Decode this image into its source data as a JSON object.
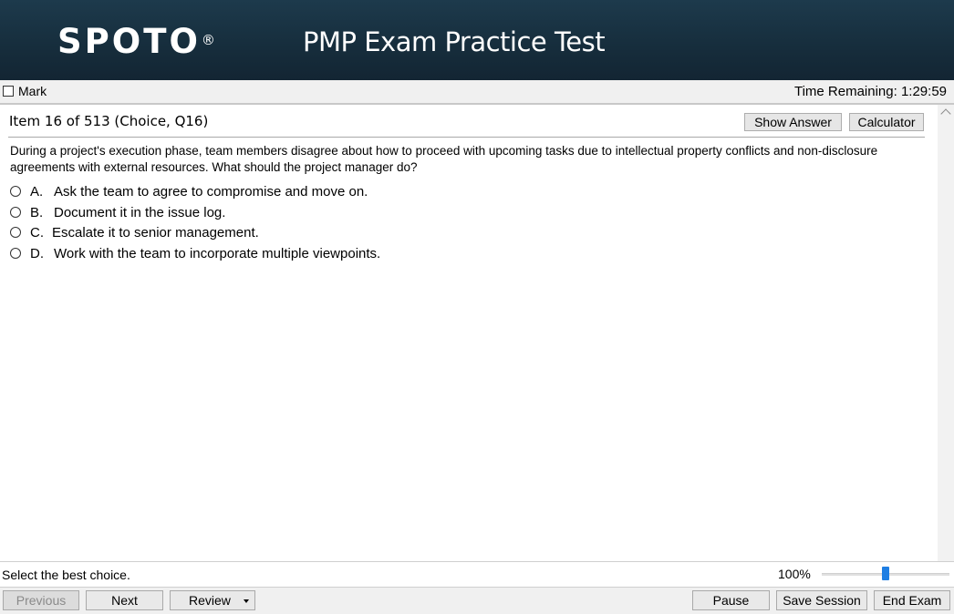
{
  "header": {
    "logo": "SPOTO",
    "logo_mark": "®",
    "title": "PMP Exam Practice Test"
  },
  "markbar": {
    "mark_label": "Mark",
    "mark_checked": false,
    "timer": "Time Remaining: 1:29:59"
  },
  "item": {
    "title": "Item 16 of 513 (Choice, Q16)",
    "show_answer_label": "Show Answer",
    "calculator_label": "Calculator",
    "question": "During a project's execution phase, team members disagree about how to proceed with upcoming tasks due to intellectual property conflicts and non-disclosure agreements with external resources. What should the project manager do?",
    "options": [
      {
        "letter": "A.",
        "text": "Ask the team to agree to compromise and move on."
      },
      {
        "letter": "B.",
        "text": "Document it in the issue log."
      },
      {
        "letter": "C.",
        "text": "Escalate it to senior management."
      },
      {
        "letter": "D.",
        "text": "Work with the team to incorporate multiple viewpoints."
      }
    ]
  },
  "status": {
    "text": "Select the best choice.",
    "zoom": "100%",
    "zoom_level": 0.5
  },
  "footer": {
    "previous_label": "Previous",
    "next_label": "Next",
    "review_label": "Review",
    "pause_label": "Pause",
    "save_session_label": "Save Session",
    "end_exam_label": "End Exam"
  },
  "colors": {
    "header_bg": "#1b3446",
    "accent": "#1e7ee3"
  }
}
